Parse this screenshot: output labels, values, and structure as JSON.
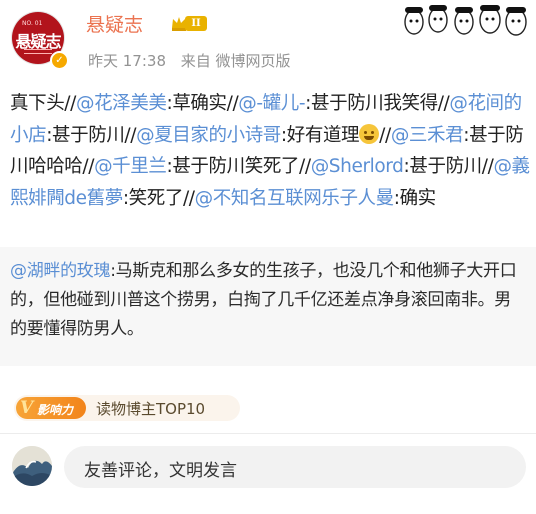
{
  "post": {
    "author": {
      "name": "悬疑志",
      "vip_level": "II",
      "avatar_logo": "悬疑志",
      "avatar_issue": "NO. 01"
    },
    "time": "昨天 17:38",
    "source": "来自 微博网页版",
    "content": [
      {
        "t": "text",
        "v": "真下头//"
      },
      {
        "t": "mention",
        "v": "@花泽美美"
      },
      {
        "t": "text",
        "v": ":草确实//"
      },
      {
        "t": "mention",
        "v": "@-罐儿-"
      },
      {
        "t": "text",
        "v": ":甚于防川我笑得//"
      },
      {
        "t": "mention",
        "v": "@花间的小店"
      },
      {
        "t": "text",
        "v": ":甚于防川//"
      },
      {
        "t": "mention",
        "v": "@夏目家的小诗哥"
      },
      {
        "t": "text",
        "v": ":好有道理"
      },
      {
        "t": "emoji",
        "v": "laughing-tears"
      },
      {
        "t": "text",
        "v": "//"
      },
      {
        "t": "mention",
        "v": "@三禾君"
      },
      {
        "t": "text",
        "v": ":甚于防川哈哈哈//"
      },
      {
        "t": "mention",
        "v": "@千里兰"
      },
      {
        "t": "text",
        "v": ":甚于防川笑死了//"
      },
      {
        "t": "mention",
        "v": "@Sherlord"
      },
      {
        "t": "text",
        "v": ":甚于防川//"
      },
      {
        "t": "mention",
        "v": "@義熙婔闁de舊夢"
      },
      {
        "t": "text",
        "v": ":笑死了//"
      },
      {
        "t": "mention",
        "v": "@不知名互联网乐子人曼"
      },
      {
        "t": "text",
        "v": ":确实"
      }
    ]
  },
  "repost": {
    "mention": "@湖畔的玫瑰",
    "text": ":马斯克和那么多女的生孩子，也没几个和他狮子大开口的，但他碰到川普这个捞男，白掏了几千亿还差点净身滚回南非。男的要懂得防男人。"
  },
  "badge": {
    "pill_text": "影响力",
    "label": "读物博主TOP10"
  },
  "comment": {
    "placeholder": "友善评论，文明发言"
  },
  "colors": {
    "username": "#eb7350",
    "mention": "#5b8fd4",
    "meta": "#939393",
    "vip": "#e9b200"
  }
}
